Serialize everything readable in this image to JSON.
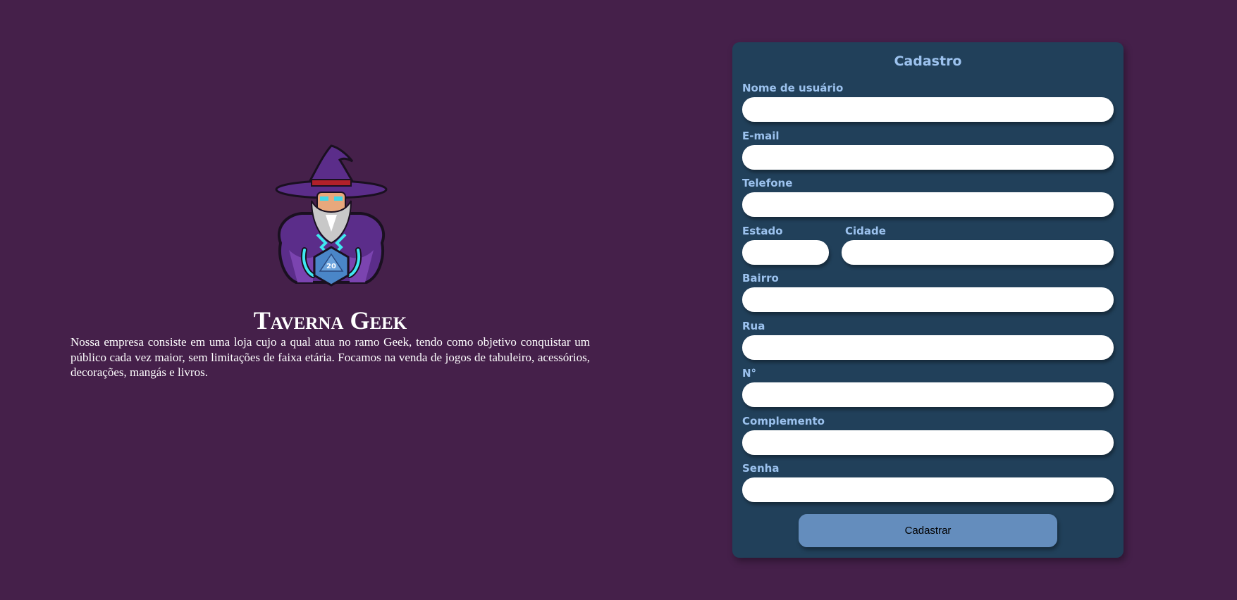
{
  "brand": {
    "title": "Taverna Geek",
    "description": "Nossa empresa consiste em uma loja cujo a qual atua no ramo Geek, tendo como objetivo conquistar um público cada vez maior, sem limitações de faixa etária. Focamos na venda de jogos de tabuleiro, acessórios, decorações, mangás e livros.",
    "logo_icon": "wizard-logo-icon",
    "dice_number": "20"
  },
  "form": {
    "title": "Cadastro",
    "fields": {
      "username": {
        "label": "Nome de usuário",
        "value": ""
      },
      "email": {
        "label": "E-mail",
        "value": ""
      },
      "phone": {
        "label": "Telefone",
        "value": ""
      },
      "state": {
        "label": "Estado",
        "value": ""
      },
      "city": {
        "label": "Cidade",
        "value": ""
      },
      "district": {
        "label": "Bairro",
        "value": ""
      },
      "street": {
        "label": "Rua",
        "value": ""
      },
      "number": {
        "label": "N°",
        "value": ""
      },
      "complement": {
        "label": "Complemento",
        "value": ""
      },
      "password": {
        "label": "Senha",
        "value": ""
      }
    },
    "submit_label": "Cadastrar"
  },
  "colors": {
    "background": "#45204a",
    "card": "#21405a",
    "label": "#9cc2ee",
    "button": "#648dbd"
  }
}
